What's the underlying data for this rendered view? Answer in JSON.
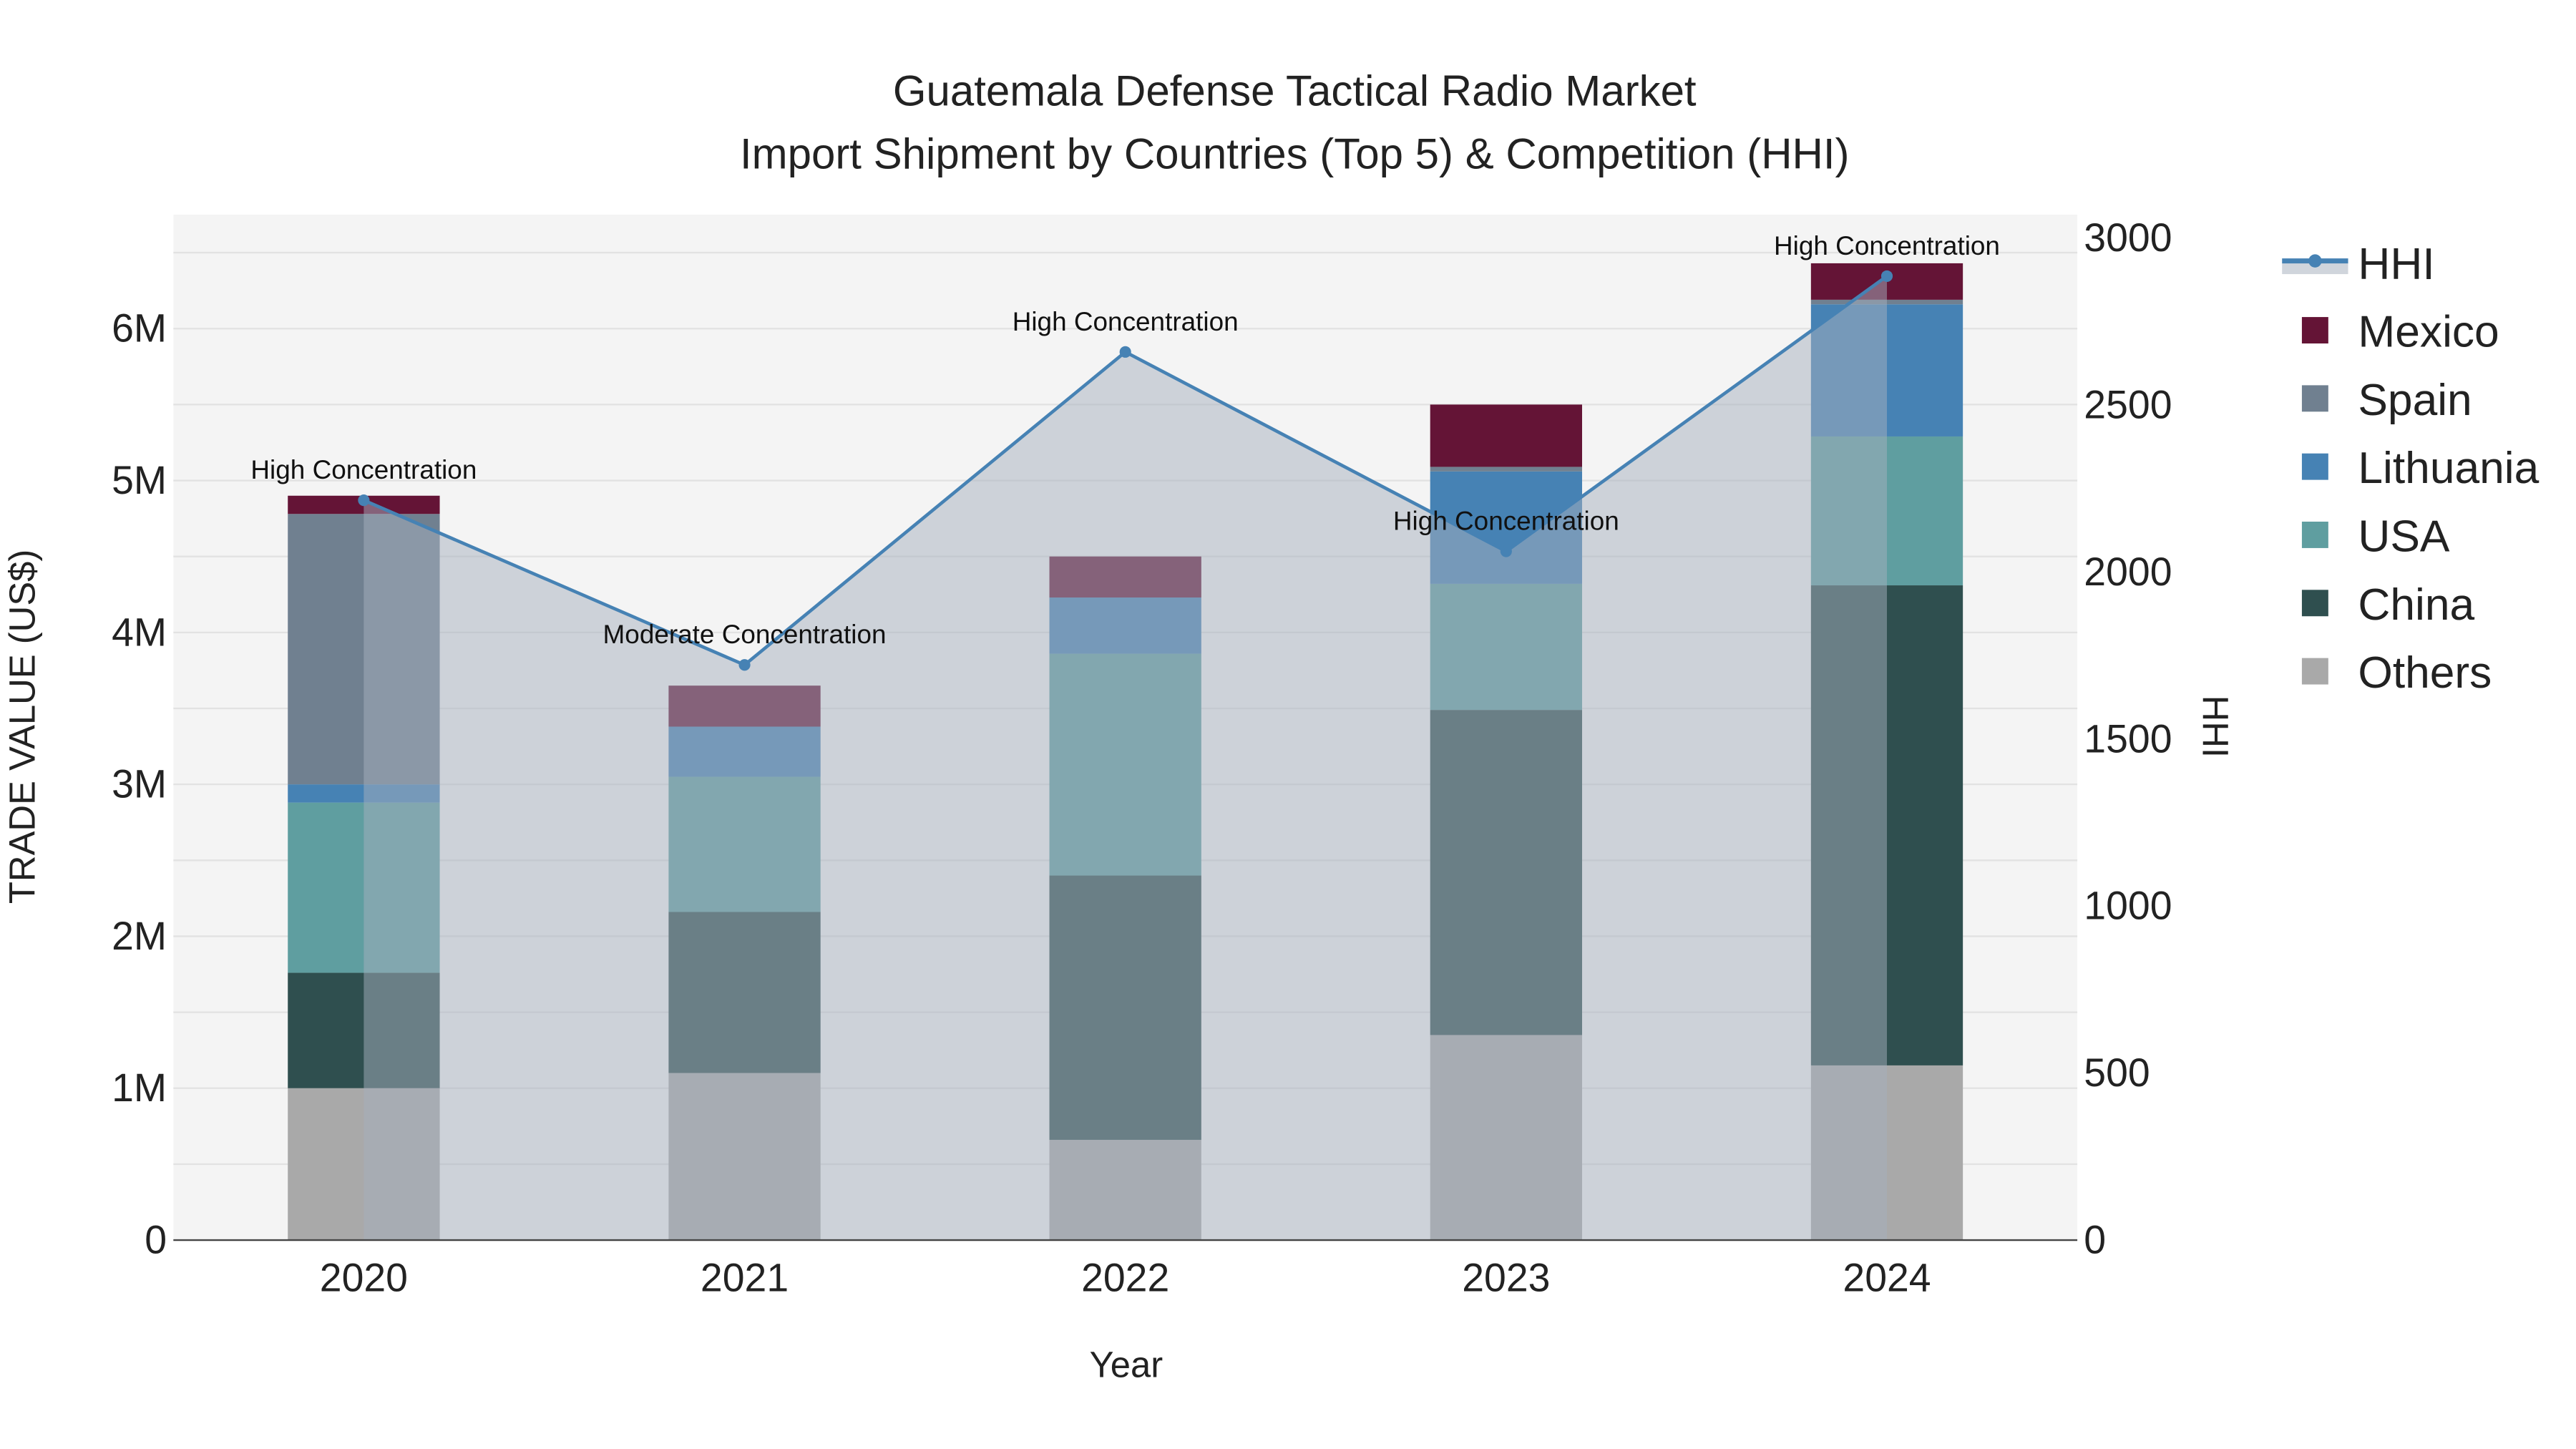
{
  "chart_data": {
    "type": "bar",
    "title": "Guatemala Defense Tactical Radio Market",
    "subtitle": "Import Shipment by Countries (Top 5) & Competition (HHI)",
    "xlabel": "Year",
    "ylabel": "TRADE VALUE (US$)",
    "y2label": "HHI",
    "categories": [
      "2020",
      "2021",
      "2022",
      "2023",
      "2024"
    ],
    "ylim": [
      0,
      6750000
    ],
    "y2lim": [
      0,
      3070
    ],
    "yticks": [
      0,
      1000000,
      2000000,
      3000000,
      4000000,
      5000000,
      6000000
    ],
    "ytick_labels": [
      "0",
      "1M",
      "2M",
      "3M",
      "4M",
      "5M",
      "6M"
    ],
    "y2ticks": [
      0,
      500,
      1000,
      1500,
      2000,
      2500,
      3000
    ],
    "y2tick_labels": [
      "0",
      "500",
      "1000",
      "1500",
      "2000",
      "2500",
      "3000"
    ],
    "grid": true,
    "stacked": true,
    "legend_position": "right",
    "series": [
      {
        "name": "Others",
        "color": "#A9A9A9",
        "values": [
          1000000,
          1100000,
          660000,
          1350000,
          1150000
        ]
      },
      {
        "name": "China",
        "color": "#2F4F4F",
        "values": [
          760000,
          1060000,
          1740000,
          2140000,
          3160000
        ]
      },
      {
        "name": "USA",
        "color": "#5F9EA0",
        "values": [
          1120000,
          890000,
          1460000,
          830000,
          980000
        ]
      },
      {
        "name": "Lithuania",
        "color": "#4682B4",
        "values": [
          120000,
          330000,
          370000,
          740000,
          870000
        ]
      },
      {
        "name": "Spain",
        "color": "#708090",
        "values": [
          1780000,
          0,
          0,
          30000,
          30000
        ]
      },
      {
        "name": "Mexico",
        "color": "#641436",
        "values": [
          120000,
          270000,
          270000,
          410000,
          240000
        ]
      }
    ],
    "legend_order": [
      "HHI",
      "Mexico",
      "Spain",
      "Lithuania",
      "USA",
      "China",
      "Others"
    ],
    "line": {
      "name": "HHI",
      "color": "#4682B4",
      "values": [
        2215,
        1722,
        2659,
        2062,
        2886
      ],
      "annotations": [
        "High Concentration",
        "Moderate Concentration",
        "High Concentration",
        "High Concentration",
        "High Concentration"
      ]
    }
  }
}
